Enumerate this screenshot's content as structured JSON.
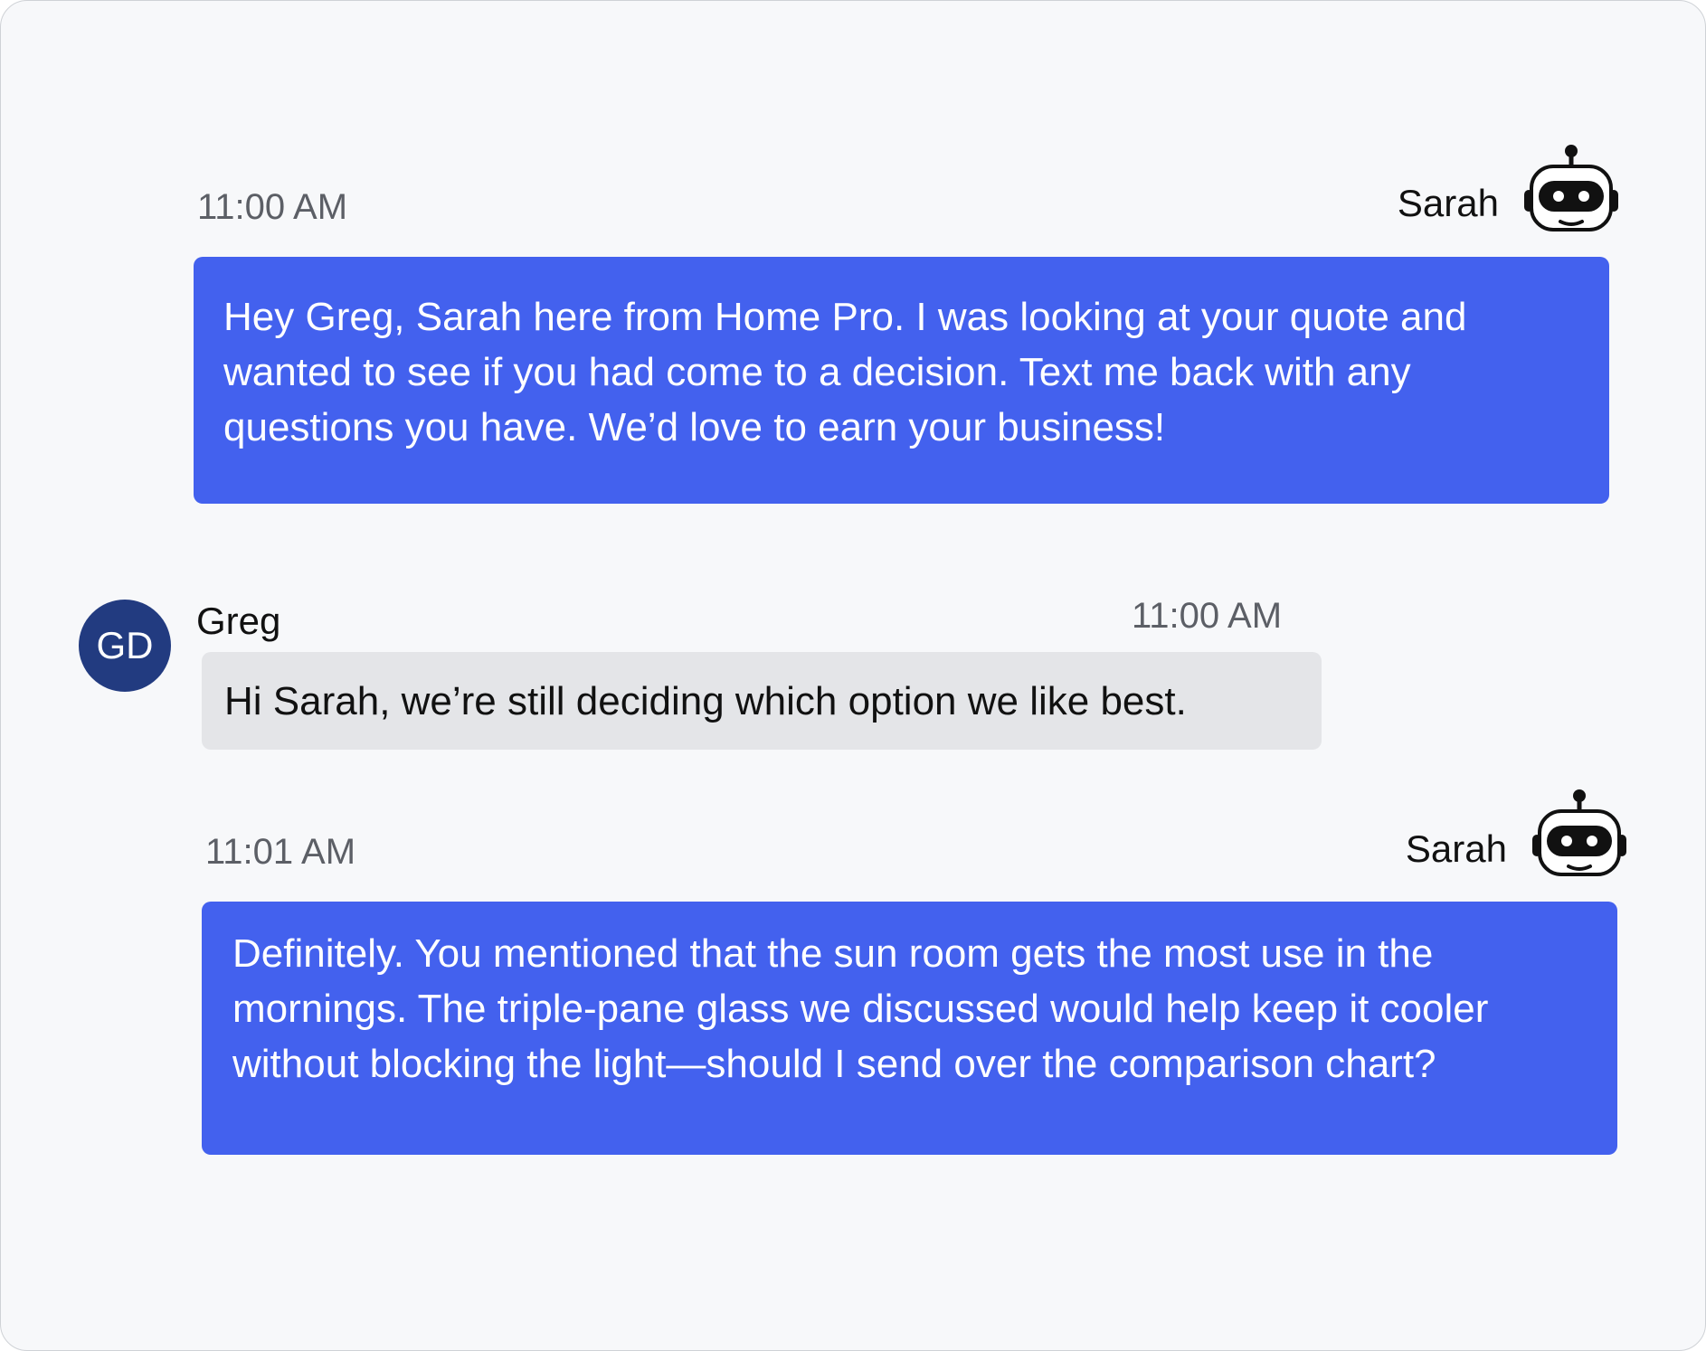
{
  "messages": [
    {
      "sender": "Sarah",
      "time": "11:00 AM",
      "text": "Hey Greg, Sarah here from Home Pro. I was looking at your quote and wanted to see if you had come to a decision. Text me back with any questions you have. We’d love to earn your business!",
      "avatar_icon": "robot-icon"
    },
    {
      "sender": "Greg",
      "time": "11:00 AM",
      "text": "Hi Sarah, we’re still deciding which option we like best.",
      "avatar_initials": "GD"
    },
    {
      "sender": "Sarah",
      "time": "11:01 AM",
      "text": "Definitely. You mentioned that the sun room gets the most use in the mornings. The triple-pane glass we discussed would help keep it cooler without blocking the light—should I send over the comparison chart?",
      "avatar_icon": "robot-icon"
    }
  ],
  "colors": {
    "agent_bubble": "#4361ee",
    "customer_bubble": "#e4e5e8",
    "avatar_bg": "#223b80",
    "background": "#f7f8fa"
  }
}
